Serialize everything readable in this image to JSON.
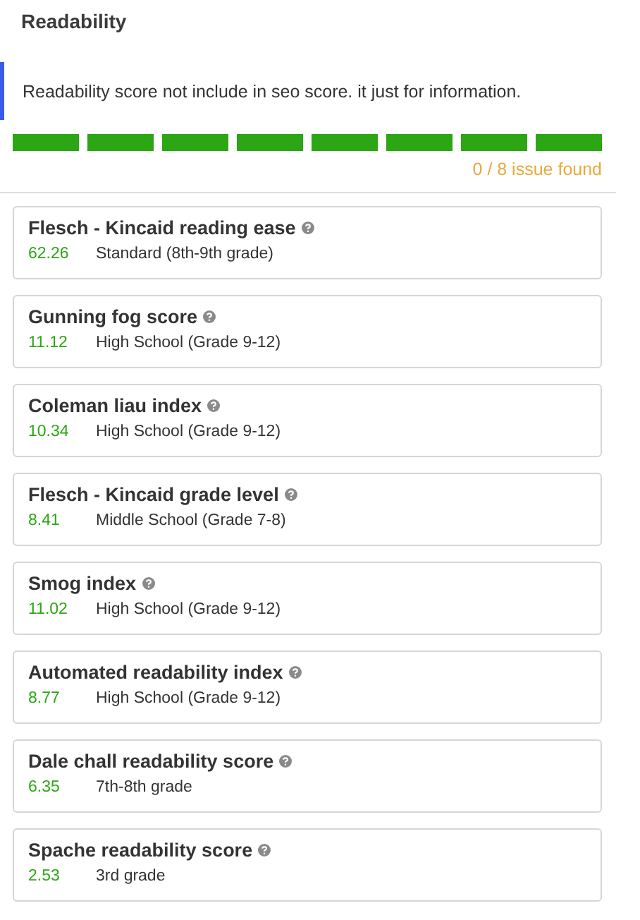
{
  "panel": {
    "title": "Readability"
  },
  "notice": "Readability score not include in seo score. it just for information.",
  "segments": [
    {
      "passed": true
    },
    {
      "passed": true
    },
    {
      "passed": true
    },
    {
      "passed": true
    },
    {
      "passed": true
    },
    {
      "passed": true
    },
    {
      "passed": true
    },
    {
      "passed": true
    }
  ],
  "issue_count": "0 / 8 issue found",
  "metrics": [
    {
      "name": "Flesch - Kincaid reading ease",
      "score": "62.26",
      "grade": "Standard (8th-9th grade)"
    },
    {
      "name": "Gunning fog score",
      "score": "11.12",
      "grade": "High School (Grade 9-12)"
    },
    {
      "name": "Coleman liau index",
      "score": "10.34",
      "grade": "High School (Grade 9-12)"
    },
    {
      "name": "Flesch - Kincaid grade level",
      "score": "8.41",
      "grade": "Middle School (Grade 7-8)"
    },
    {
      "name": "Smog index",
      "score": "11.02",
      "grade": "High School (Grade 9-12)"
    },
    {
      "name": "Automated readability index",
      "score": "8.77",
      "grade": "High School (Grade 9-12)"
    },
    {
      "name": "Dale chall readability score",
      "score": "6.35",
      "grade": "7th-8th grade"
    },
    {
      "name": "Spache readability score",
      "score": "2.53",
      "grade": "3rd grade"
    }
  ]
}
